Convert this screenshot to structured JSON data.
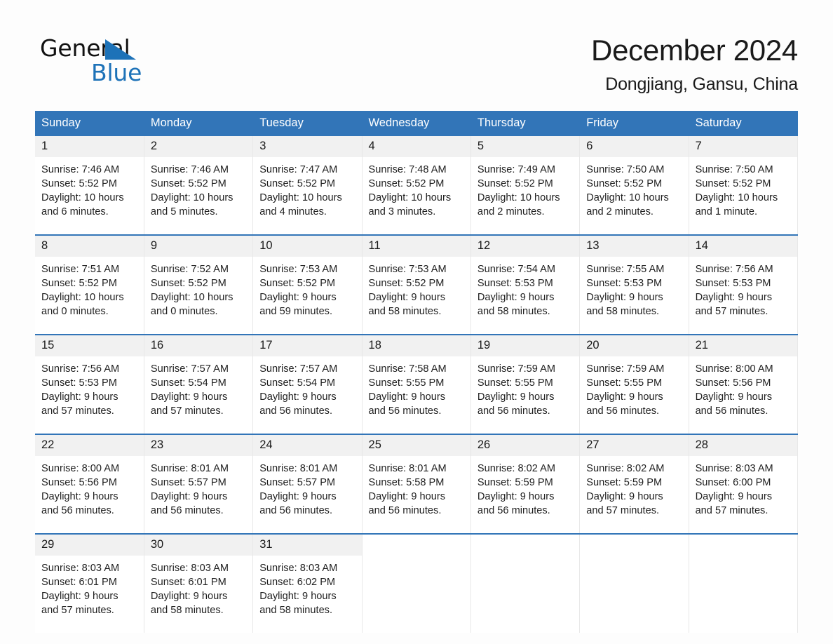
{
  "brand": {
    "name_part1": "General",
    "name_part2": "Blue",
    "accent_color": "#1d72b8"
  },
  "header": {
    "title": "December 2024",
    "subtitle": "Dongjiang, Gansu, China"
  },
  "calendar": {
    "header_bg": "#3275b8",
    "daynum_bg": "#f1f1f1",
    "weekday_headers": [
      "Sunday",
      "Monday",
      "Tuesday",
      "Wednesday",
      "Thursday",
      "Friday",
      "Saturday"
    ],
    "weeks": [
      [
        {
          "day": "1",
          "sunrise": "Sunrise: 7:46 AM",
          "sunset": "Sunset: 5:52 PM",
          "daylight": "Daylight: 10 hours and 6 minutes."
        },
        {
          "day": "2",
          "sunrise": "Sunrise: 7:46 AM",
          "sunset": "Sunset: 5:52 PM",
          "daylight": "Daylight: 10 hours and 5 minutes."
        },
        {
          "day": "3",
          "sunrise": "Sunrise: 7:47 AM",
          "sunset": "Sunset: 5:52 PM",
          "daylight": "Daylight: 10 hours and 4 minutes."
        },
        {
          "day": "4",
          "sunrise": "Sunrise: 7:48 AM",
          "sunset": "Sunset: 5:52 PM",
          "daylight": "Daylight: 10 hours and 3 minutes."
        },
        {
          "day": "5",
          "sunrise": "Sunrise: 7:49 AM",
          "sunset": "Sunset: 5:52 PM",
          "daylight": "Daylight: 10 hours and 2 minutes."
        },
        {
          "day": "6",
          "sunrise": "Sunrise: 7:50 AM",
          "sunset": "Sunset: 5:52 PM",
          "daylight": "Daylight: 10 hours and 2 minutes."
        },
        {
          "day": "7",
          "sunrise": "Sunrise: 7:50 AM",
          "sunset": "Sunset: 5:52 PM",
          "daylight": "Daylight: 10 hours and 1 minute."
        }
      ],
      [
        {
          "day": "8",
          "sunrise": "Sunrise: 7:51 AM",
          "sunset": "Sunset: 5:52 PM",
          "daylight": "Daylight: 10 hours and 0 minutes."
        },
        {
          "day": "9",
          "sunrise": "Sunrise: 7:52 AM",
          "sunset": "Sunset: 5:52 PM",
          "daylight": "Daylight: 10 hours and 0 minutes."
        },
        {
          "day": "10",
          "sunrise": "Sunrise: 7:53 AM",
          "sunset": "Sunset: 5:52 PM",
          "daylight": "Daylight: 9 hours and 59 minutes."
        },
        {
          "day": "11",
          "sunrise": "Sunrise: 7:53 AM",
          "sunset": "Sunset: 5:52 PM",
          "daylight": "Daylight: 9 hours and 58 minutes."
        },
        {
          "day": "12",
          "sunrise": "Sunrise: 7:54 AM",
          "sunset": "Sunset: 5:53 PM",
          "daylight": "Daylight: 9 hours and 58 minutes."
        },
        {
          "day": "13",
          "sunrise": "Sunrise: 7:55 AM",
          "sunset": "Sunset: 5:53 PM",
          "daylight": "Daylight: 9 hours and 58 minutes."
        },
        {
          "day": "14",
          "sunrise": "Sunrise: 7:56 AM",
          "sunset": "Sunset: 5:53 PM",
          "daylight": "Daylight: 9 hours and 57 minutes."
        }
      ],
      [
        {
          "day": "15",
          "sunrise": "Sunrise: 7:56 AM",
          "sunset": "Sunset: 5:53 PM",
          "daylight": "Daylight: 9 hours and 57 minutes."
        },
        {
          "day": "16",
          "sunrise": "Sunrise: 7:57 AM",
          "sunset": "Sunset: 5:54 PM",
          "daylight": "Daylight: 9 hours and 57 minutes."
        },
        {
          "day": "17",
          "sunrise": "Sunrise: 7:57 AM",
          "sunset": "Sunset: 5:54 PM",
          "daylight": "Daylight: 9 hours and 56 minutes."
        },
        {
          "day": "18",
          "sunrise": "Sunrise: 7:58 AM",
          "sunset": "Sunset: 5:55 PM",
          "daylight": "Daylight: 9 hours and 56 minutes."
        },
        {
          "day": "19",
          "sunrise": "Sunrise: 7:59 AM",
          "sunset": "Sunset: 5:55 PM",
          "daylight": "Daylight: 9 hours and 56 minutes."
        },
        {
          "day": "20",
          "sunrise": "Sunrise: 7:59 AM",
          "sunset": "Sunset: 5:55 PM",
          "daylight": "Daylight: 9 hours and 56 minutes."
        },
        {
          "day": "21",
          "sunrise": "Sunrise: 8:00 AM",
          "sunset": "Sunset: 5:56 PM",
          "daylight": "Daylight: 9 hours and 56 minutes."
        }
      ],
      [
        {
          "day": "22",
          "sunrise": "Sunrise: 8:00 AM",
          "sunset": "Sunset: 5:56 PM",
          "daylight": "Daylight: 9 hours and 56 minutes."
        },
        {
          "day": "23",
          "sunrise": "Sunrise: 8:01 AM",
          "sunset": "Sunset: 5:57 PM",
          "daylight": "Daylight: 9 hours and 56 minutes."
        },
        {
          "day": "24",
          "sunrise": "Sunrise: 8:01 AM",
          "sunset": "Sunset: 5:57 PM",
          "daylight": "Daylight: 9 hours and 56 minutes."
        },
        {
          "day": "25",
          "sunrise": "Sunrise: 8:01 AM",
          "sunset": "Sunset: 5:58 PM",
          "daylight": "Daylight: 9 hours and 56 minutes."
        },
        {
          "day": "26",
          "sunrise": "Sunrise: 8:02 AM",
          "sunset": "Sunset: 5:59 PM",
          "daylight": "Daylight: 9 hours and 56 minutes."
        },
        {
          "day": "27",
          "sunrise": "Sunrise: 8:02 AM",
          "sunset": "Sunset: 5:59 PM",
          "daylight": "Daylight: 9 hours and 57 minutes."
        },
        {
          "day": "28",
          "sunrise": "Sunrise: 8:03 AM",
          "sunset": "Sunset: 6:00 PM",
          "daylight": "Daylight: 9 hours and 57 minutes."
        }
      ],
      [
        {
          "day": "29",
          "sunrise": "Sunrise: 8:03 AM",
          "sunset": "Sunset: 6:01 PM",
          "daylight": "Daylight: 9 hours and 57 minutes."
        },
        {
          "day": "30",
          "sunrise": "Sunrise: 8:03 AM",
          "sunset": "Sunset: 6:01 PM",
          "daylight": "Daylight: 9 hours and 58 minutes."
        },
        {
          "day": "31",
          "sunrise": "Sunrise: 8:03 AM",
          "sunset": "Sunset: 6:02 PM",
          "daylight": "Daylight: 9 hours and 58 minutes."
        },
        {
          "day": "",
          "sunrise": "",
          "sunset": "",
          "daylight": ""
        },
        {
          "day": "",
          "sunrise": "",
          "sunset": "",
          "daylight": ""
        },
        {
          "day": "",
          "sunrise": "",
          "sunset": "",
          "daylight": ""
        },
        {
          "day": "",
          "sunrise": "",
          "sunset": "",
          "daylight": ""
        }
      ]
    ]
  }
}
